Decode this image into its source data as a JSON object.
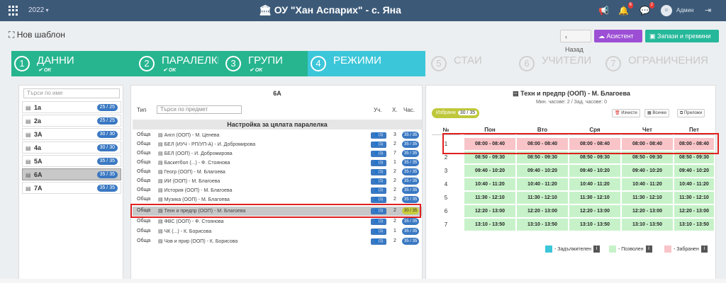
{
  "app": {
    "year": "2022",
    "school": "ОУ \"Хан Аспарих\" - с. Яна",
    "user": "Админ",
    "notif_badges": [
      "6",
      "2"
    ],
    "page_title": "Нов шаблон"
  },
  "toolbar": {
    "back_label": "Назад",
    "assistant_label": "Асистент",
    "save_label": "Запази и премини"
  },
  "steps": [
    {
      "num": "1",
      "label": "ДАННИ",
      "status": "OK",
      "state": "done"
    },
    {
      "num": "2",
      "label": "ПАРАЛЕЛКИ",
      "status": "OK",
      "state": "done"
    },
    {
      "num": "3",
      "label": "ГРУПИ",
      "status": "OK",
      "state": "done"
    },
    {
      "num": "4",
      "label": "РЕЖИМИ",
      "status": "",
      "state": "active"
    },
    {
      "num": "5",
      "label": "СТАИ",
      "status": "",
      "state": "todo"
    },
    {
      "num": "6",
      "label": "УЧИТЕЛИ",
      "status": "",
      "state": "todo"
    },
    {
      "num": "7",
      "label": "ОГРАНИЧЕНИЯ",
      "status": "",
      "state": "todo"
    }
  ],
  "classes": {
    "search_placeholder": "Търси по име",
    "items": [
      {
        "name": "1а",
        "count": "25 / 25"
      },
      {
        "name": "2а",
        "count": "25 / 25"
      },
      {
        "name": "3А",
        "count": "30 / 30"
      },
      {
        "name": "4а",
        "count": "30 / 30"
      },
      {
        "name": "5А",
        "count": "35 / 35"
      },
      {
        "name": "6А",
        "count": "35 / 35",
        "selected": true
      },
      {
        "name": "7А",
        "count": "35 / 35"
      }
    ]
  },
  "subjects": {
    "title": "6А",
    "col_type": "Тип",
    "search_placeholder": "Търси по предмет",
    "col_teacher": "Уч.",
    "col_h": "Х.",
    "col_hours": "Час.",
    "all_class_label": "Настройка за цялата паралелка",
    "rows": [
      {
        "type": "Обща",
        "name": "Англ (ООП) - М. Ценева",
        "teacher_chip": "(1)",
        "h": "3",
        "pill": "35 / 35"
      },
      {
        "type": "Обща",
        "name": "БЕЛ (ИУЧ - РП/УП-А) - И. Добромирова",
        "teacher_chip": "(1)",
        "h": "2",
        "pill": "35 / 35"
      },
      {
        "type": "Обща",
        "name": "БЕЛ (ООП) - И. Добромирова",
        "teacher_chip": "(1)",
        "h": "7",
        "pill": "35 / 35"
      },
      {
        "type": "Обща",
        "name": "Баскетбол (...) - Ф. Стоянова",
        "teacher_chip": "(1)",
        "h": "1",
        "pill": "35 / 35"
      },
      {
        "type": "Обща",
        "name": "Геогр (ООП) - М. Благоева",
        "teacher_chip": "(1)",
        "h": "2",
        "pill": "35 / 35"
      },
      {
        "type": "Обща",
        "name": "ИИ (ООП) - М. Благоева",
        "teacher_chip": "(1)",
        "h": "2",
        "pill": "35 / 35"
      },
      {
        "type": "Обща",
        "name": "История (ООП) - М. Благоева",
        "teacher_chip": "(1)",
        "h": "2",
        "pill": "35 / 35"
      },
      {
        "type": "Обща",
        "name": "Музика (ООП) - М. Благоева",
        "teacher_chip": "(1)",
        "h": "2",
        "pill": "35 / 35"
      },
      {
        "type": "Обща",
        "name": "Техн и предпр (ООП) - М. Благоева",
        "teacher_chip": "(1)",
        "h": "2",
        "pill": "30 / 35",
        "selected": true
      },
      {
        "type": "Обща",
        "name": "ФВС (ООП) - Ф. Стоянова",
        "teacher_chip": "(1)",
        "h": "2",
        "pill": "35 / 35"
      },
      {
        "type": "Обща",
        "name": "ЧК (...) - К. Борисова",
        "teacher_chip": "(1)",
        "h": "1",
        "pill": "35 / 35"
      },
      {
        "type": "Обща",
        "name": "Чов и прир (ООП) - К. Борисова",
        "teacher_chip": "(1)",
        "h": "2",
        "pill": "35 / 35"
      }
    ]
  },
  "modes": {
    "title": "Техн и предпр (ООП) - М. Благоева",
    "subtitle": "Мин. часове: 2 / Зад. часове: 0",
    "selected_label": "Избрани",
    "selected_value": "30 / 35",
    "clear_label": "Изчисти",
    "all_label": "Всички",
    "apply_label": "Приложи",
    "col_no": "№",
    "days": [
      "Пон",
      "Вто",
      "Сря",
      "Чет",
      "Пет"
    ],
    "rows": [
      {
        "no": "1",
        "time": "08:00 - 08:40",
        "state": "forbidden"
      },
      {
        "no": "2",
        "time": "08:50 - 09:30",
        "state": "allowed"
      },
      {
        "no": "3",
        "time": "09:40 - 10:20",
        "state": "allowed"
      },
      {
        "no": "4",
        "time": "10:40 - 11:20",
        "state": "allowed"
      },
      {
        "no": "5",
        "time": "11:30 - 12:10",
        "state": "allowed"
      },
      {
        "no": "6",
        "time": "12:20 - 13:00",
        "state": "allowed"
      },
      {
        "no": "7",
        "time": "13:10 - 13:50",
        "state": "allowed"
      }
    ],
    "legend": [
      {
        "label": "- Задължителен",
        "color": "#3cc6d9"
      },
      {
        "label": "- Позволен",
        "color": "#c7f2c9"
      },
      {
        "label": "- Забранен",
        "color": "#f8c4c8"
      }
    ]
  }
}
